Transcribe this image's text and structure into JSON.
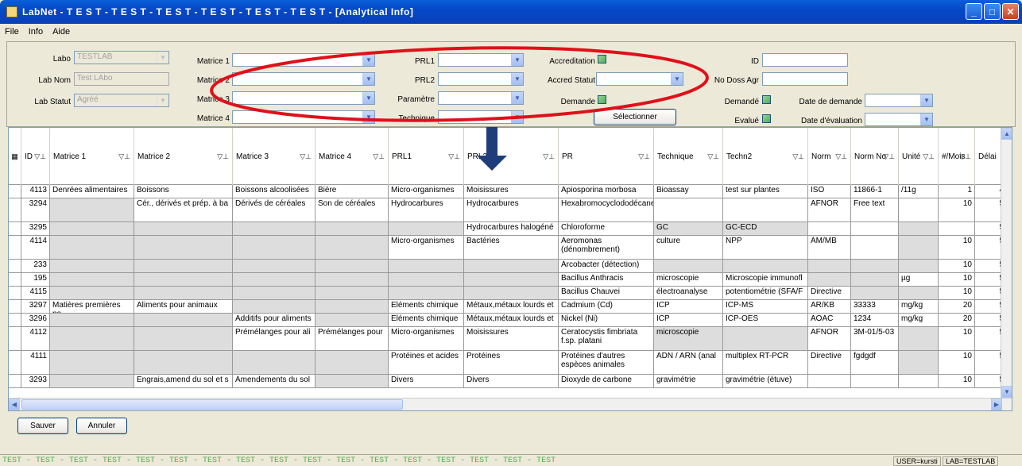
{
  "window": {
    "title": "LabNet - T E S T  -  T E S T  -  T E S T  -  T E S T  -  T E S T  -  T E S T - [Analytical Info]"
  },
  "menu": [
    "File",
    "Info",
    "Aide"
  ],
  "form": {
    "labo_label": "Labo",
    "labo_value": "TESTLAB",
    "labnom_label": "Lab Nom",
    "labnom_value": "Test LAbo",
    "labstatut_label": "Lab Statut",
    "labstatut_value": "Agréé",
    "matrice1_label": "Matrice 1",
    "matrice2_label": "Matrice 2",
    "matrice3_label": "Matrice 3",
    "matrice4_label": "Matrice 4",
    "prl1_label": "PRL1",
    "prl2_label": "PRL2",
    "parametre_label": "Paramètre",
    "technique_label": "Technique",
    "accreditation_label": "Accreditation",
    "accredstatut_label": "Accred Statut",
    "demande_label": "Demande",
    "select_button": "Sélectionner",
    "id_label": "ID",
    "nodoss_label": "No Doss Agr",
    "demande2_label": "Demandé",
    "evalue_label": "Evalué",
    "date_demande_label": "Date de demande",
    "date_eval_label": "Date d'évaluation"
  },
  "grid": {
    "headers": [
      "ID",
      "Matrice 1",
      "Matrice 2",
      "Matrice 3",
      "Matrice 4",
      "PRL1",
      "PRL2",
      "PR",
      "Technique",
      "Techn2",
      "Norm",
      "Norm No",
      "Unité",
      "#/Mois",
      "Délai"
    ],
    "rows": [
      [
        "4113",
        "Denrées alimentaires",
        "Boissons",
        "Boissons alcoolisées",
        "Bière",
        "Micro-organismes",
        "Moisissures",
        "Apiosporina morbosa",
        "Bioassay",
        "test sur plantes",
        "ISO",
        "11866-1",
        "/11g",
        "1",
        "4"
      ],
      [
        "3294",
        "",
        "Cér., dérivés et prép. à ba",
        "Dérivés de céréales",
        "Son de céréales",
        "Hydrocarbures",
        "Hydrocarbures",
        "Hexabromocyclododécane",
        "",
        "",
        "AFNOR",
        "Free text",
        "",
        "10",
        "5"
      ],
      [
        "3295",
        "",
        "",
        "",
        "",
        "",
        "Hydrocarbures halogéné",
        "Chloroforme",
        "GC",
        "GC-ECD",
        "",
        "",
        "",
        "",
        "5"
      ],
      [
        "4114",
        "",
        "",
        "",
        "",
        "Micro-organismes",
        "Bactéries",
        "Aeromonas (dénombrement)",
        "culture",
        "NPP",
        "AM/MB",
        "",
        "",
        "10",
        "5"
      ],
      [
        "233",
        "",
        "",
        "",
        "",
        "",
        "",
        "Arcobacter (détection)",
        "",
        "",
        "",
        "",
        "",
        "10",
        "5"
      ],
      [
        "195",
        "",
        "",
        "",
        "",
        "",
        "",
        "Bacillus Anthracis",
        "microscopie",
        "Microscopie immunofl",
        "",
        "",
        "µg",
        "10",
        "5"
      ],
      [
        "4115",
        "",
        "",
        "",
        "",
        "",
        "",
        "Bacillus Chauvei",
        "électroanalyse",
        "potentiométrie (SFA/F",
        "Directive",
        "",
        "",
        "10",
        "5"
      ],
      [
        "3297",
        "Matières premières po",
        "Aliments pour animaux",
        "",
        "",
        "Eléments chimique",
        "Métaux,métaux lourds et",
        "Cadmium (Cd)",
        "ICP",
        "ICP-MS",
        "AR/KB",
        "33333",
        "mg/kg",
        "20",
        "5"
      ],
      [
        "3296",
        "",
        "",
        "Additifs pour aliments",
        "",
        "Eléments chimique",
        "Métaux,métaux lourds et",
        "Nickel (Ni)",
        "ICP",
        "ICP-OES",
        "AOAC",
        "1234",
        "mg/kg",
        "20",
        "5"
      ],
      [
        "4112",
        "",
        "",
        "Prémélanges pour ali",
        "Prémélanges pour",
        "Micro-organismes",
        "Moisissures",
        "Ceratocystis fimbriata f.sp. platani",
        "microscopie",
        "",
        "AFNOR",
        "3M-01/5-03",
        "",
        "10",
        "5"
      ],
      [
        "4111",
        "",
        "",
        "",
        "",
        "Protéines et acides",
        "Protéines",
        "Protéines d'autres espèces animales",
        "ADN / ARN (anal",
        "multiplex RT-PCR",
        "Directive",
        "fgdgdf",
        "",
        "10",
        "5"
      ],
      [
        "3293",
        "",
        "Engrais,amend du sol et s",
        "Amendements du sol",
        "",
        "Divers",
        "Divers",
        "Dioxyde de carbone",
        "gravimétrie",
        "gravimétrie (étuve)",
        "",
        "",
        "",
        "10",
        "5"
      ]
    ]
  },
  "buttons": {
    "save": "Sauver",
    "cancel": "Annuler"
  },
  "status": {
    "ticker": "TEST - TEST - TEST - TEST - TEST - TEST - TEST - TEST - TEST - TEST - TEST - TEST - TEST - TEST - TEST - TEST - TEST",
    "user": "USER=kursti",
    "lab": "LAB=TESTLAB"
  },
  "colors": {
    "annotation": "#e0101a",
    "arrow": "#1f3d7a"
  }
}
